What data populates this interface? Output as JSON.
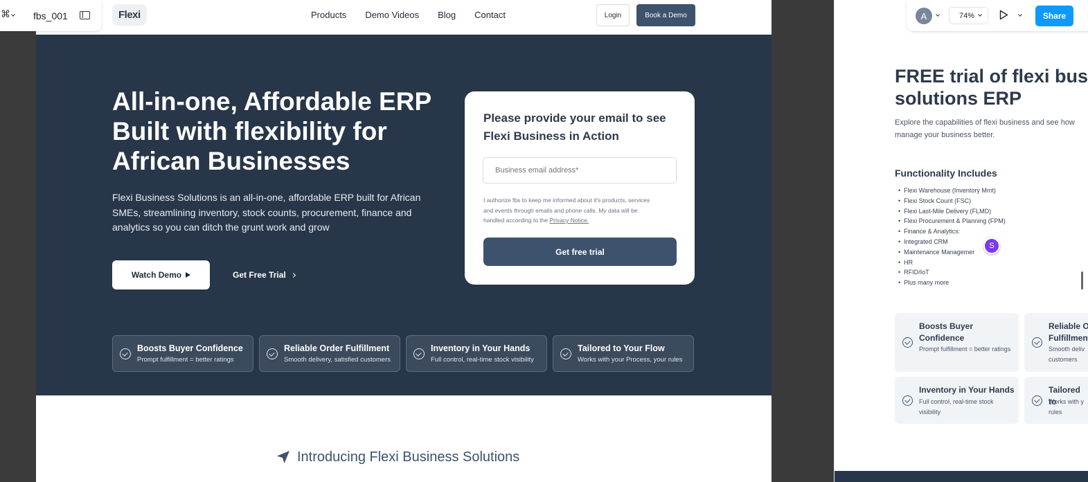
{
  "figma": {
    "file_name": "fbs_001",
    "zoom": "74%",
    "share_label": "Share",
    "avatar_initial": "A",
    "collaborator_initial": "S"
  },
  "site": {
    "logo": "Flexi",
    "nav": [
      "Products",
      "Demo Videos",
      "Blog",
      "Contact"
    ],
    "login_label": "Login",
    "book_label": "Book a Demo"
  },
  "hero": {
    "title": "All-in-one, Affordable ERP Built with flexibility for African Businesses",
    "description": "Flexi Business Solutions is an all-in-one, affordable ERP built for African SMEs, streamlining inventory, stock counts, procurement, finance and analytics so you can ditch the grunt work and grow",
    "watch_label": "Watch Demo",
    "trial_label": "Get Free Trial"
  },
  "form": {
    "title": "Please provide your email to see Flexi Business in Action",
    "email_placeholder": "Business email address*",
    "consent": "I authorize fbs to keep me informed about it's products, services and events through emails and phone calls. My data will be handled according to the",
    "privacy": "Privacy Notice.",
    "submit_label": "Get free trial"
  },
  "features": [
    {
      "title": "Boosts Buyer Confidence",
      "desc": "Prompt fulfillment = better ratings"
    },
    {
      "title": "Reliable Order Fulfillment",
      "desc": "Smooth delivery, satisfied customers"
    },
    {
      "title": "Inventory in Your Hands",
      "desc": "Full control, real-time stock visibility"
    },
    {
      "title": "Tailored to Your Flow",
      "desc": "Works with your Process, your rules"
    }
  ],
  "intro": {
    "title": "Introducing Flexi Business Solutions"
  },
  "right": {
    "title_line1": "FREE trial of flexi busin",
    "title_line2": "solutions ERP",
    "subtitle": "Explore the capabilities of flexi business and see how manage your business better.",
    "func_title": "Functionality Includes",
    "func_items": [
      "Flexi Warehouse (Inventory Mmt)",
      "Flexi Stock Count (FSC)",
      "Flexi Last-Mile Delivery (FLMD)",
      "Flexi Procurement & Planning (FPM)",
      "Finance & Analytics:",
      "Integrated CRM",
      "Maintenance Managemer",
      "HR",
      "RFID/IoT",
      "Plus many more"
    ],
    "cards": [
      {
        "title": "Boosts Buyer Confidence",
        "desc": "Prompt fulfillment = better ratings"
      },
      {
        "title": "Reliable O Fulfillment",
        "desc": "Smooth deliv customers"
      },
      {
        "title": "Inventory in Your Hands",
        "desc": "Full control, real-time stock visibility"
      },
      {
        "title": "Tailored to",
        "desc": "Works with y rules"
      }
    ]
  }
}
